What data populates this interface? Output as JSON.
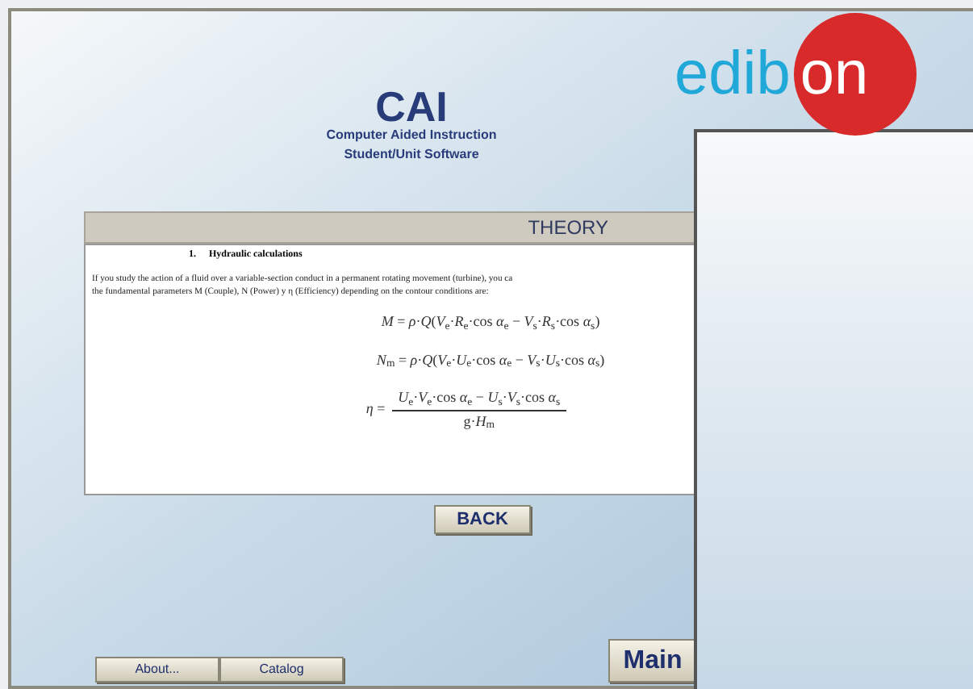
{
  "header": {
    "title": "CAI",
    "subtitle_1": "Computer Aided Instruction",
    "subtitle_2": "Student/Unit Software"
  },
  "logo": {
    "text_1": "edib",
    "text_2": "on"
  },
  "theory": {
    "title": "THEORY",
    "section_number": "1.",
    "section_title": "Hydraulic calculations",
    "paragraph_lines": [
      "If you study the action of a fluid over a variable-section conduct in a permanent rotating movement (turbine), you ca",
      "the fundamental parameters M (Couple), N (Power) y η (Efficiency) depending on the contour conditions are:"
    ],
    "formulas": [
      {
        "kind": "line",
        "text": "*M* = *ρ*·*Q*(*V*$_{e}$·*R*$_{e}$·cos *α*$_{e}$ − *V*$_{s}$·*R*$_{s}$·cos *α*$_{s}$)"
      },
      {
        "kind": "line",
        "text": "*N*$_{m}$ = *ρ*·*Q*(*V*$_{e}$·*U*$_{e}$·cos *α*$_{e}$ − *V*$_{s}$·*U*$_{s}$·cos *α*$_{s}$)"
      },
      {
        "kind": "fraction",
        "left": "*η* =",
        "numerator": "*U*$_{e}$·*V*$_{e}$·cos *α*$_{e}$ − *U*$_{s}$·*V*$_{s}$·cos *α*$_{s}$",
        "denominator": "g·*H*$_{m}$"
      }
    ]
  },
  "back_button": "BACK",
  "bottom_buttons": [
    "About...",
    "Catalog"
  ],
  "main_button": "Main"
}
